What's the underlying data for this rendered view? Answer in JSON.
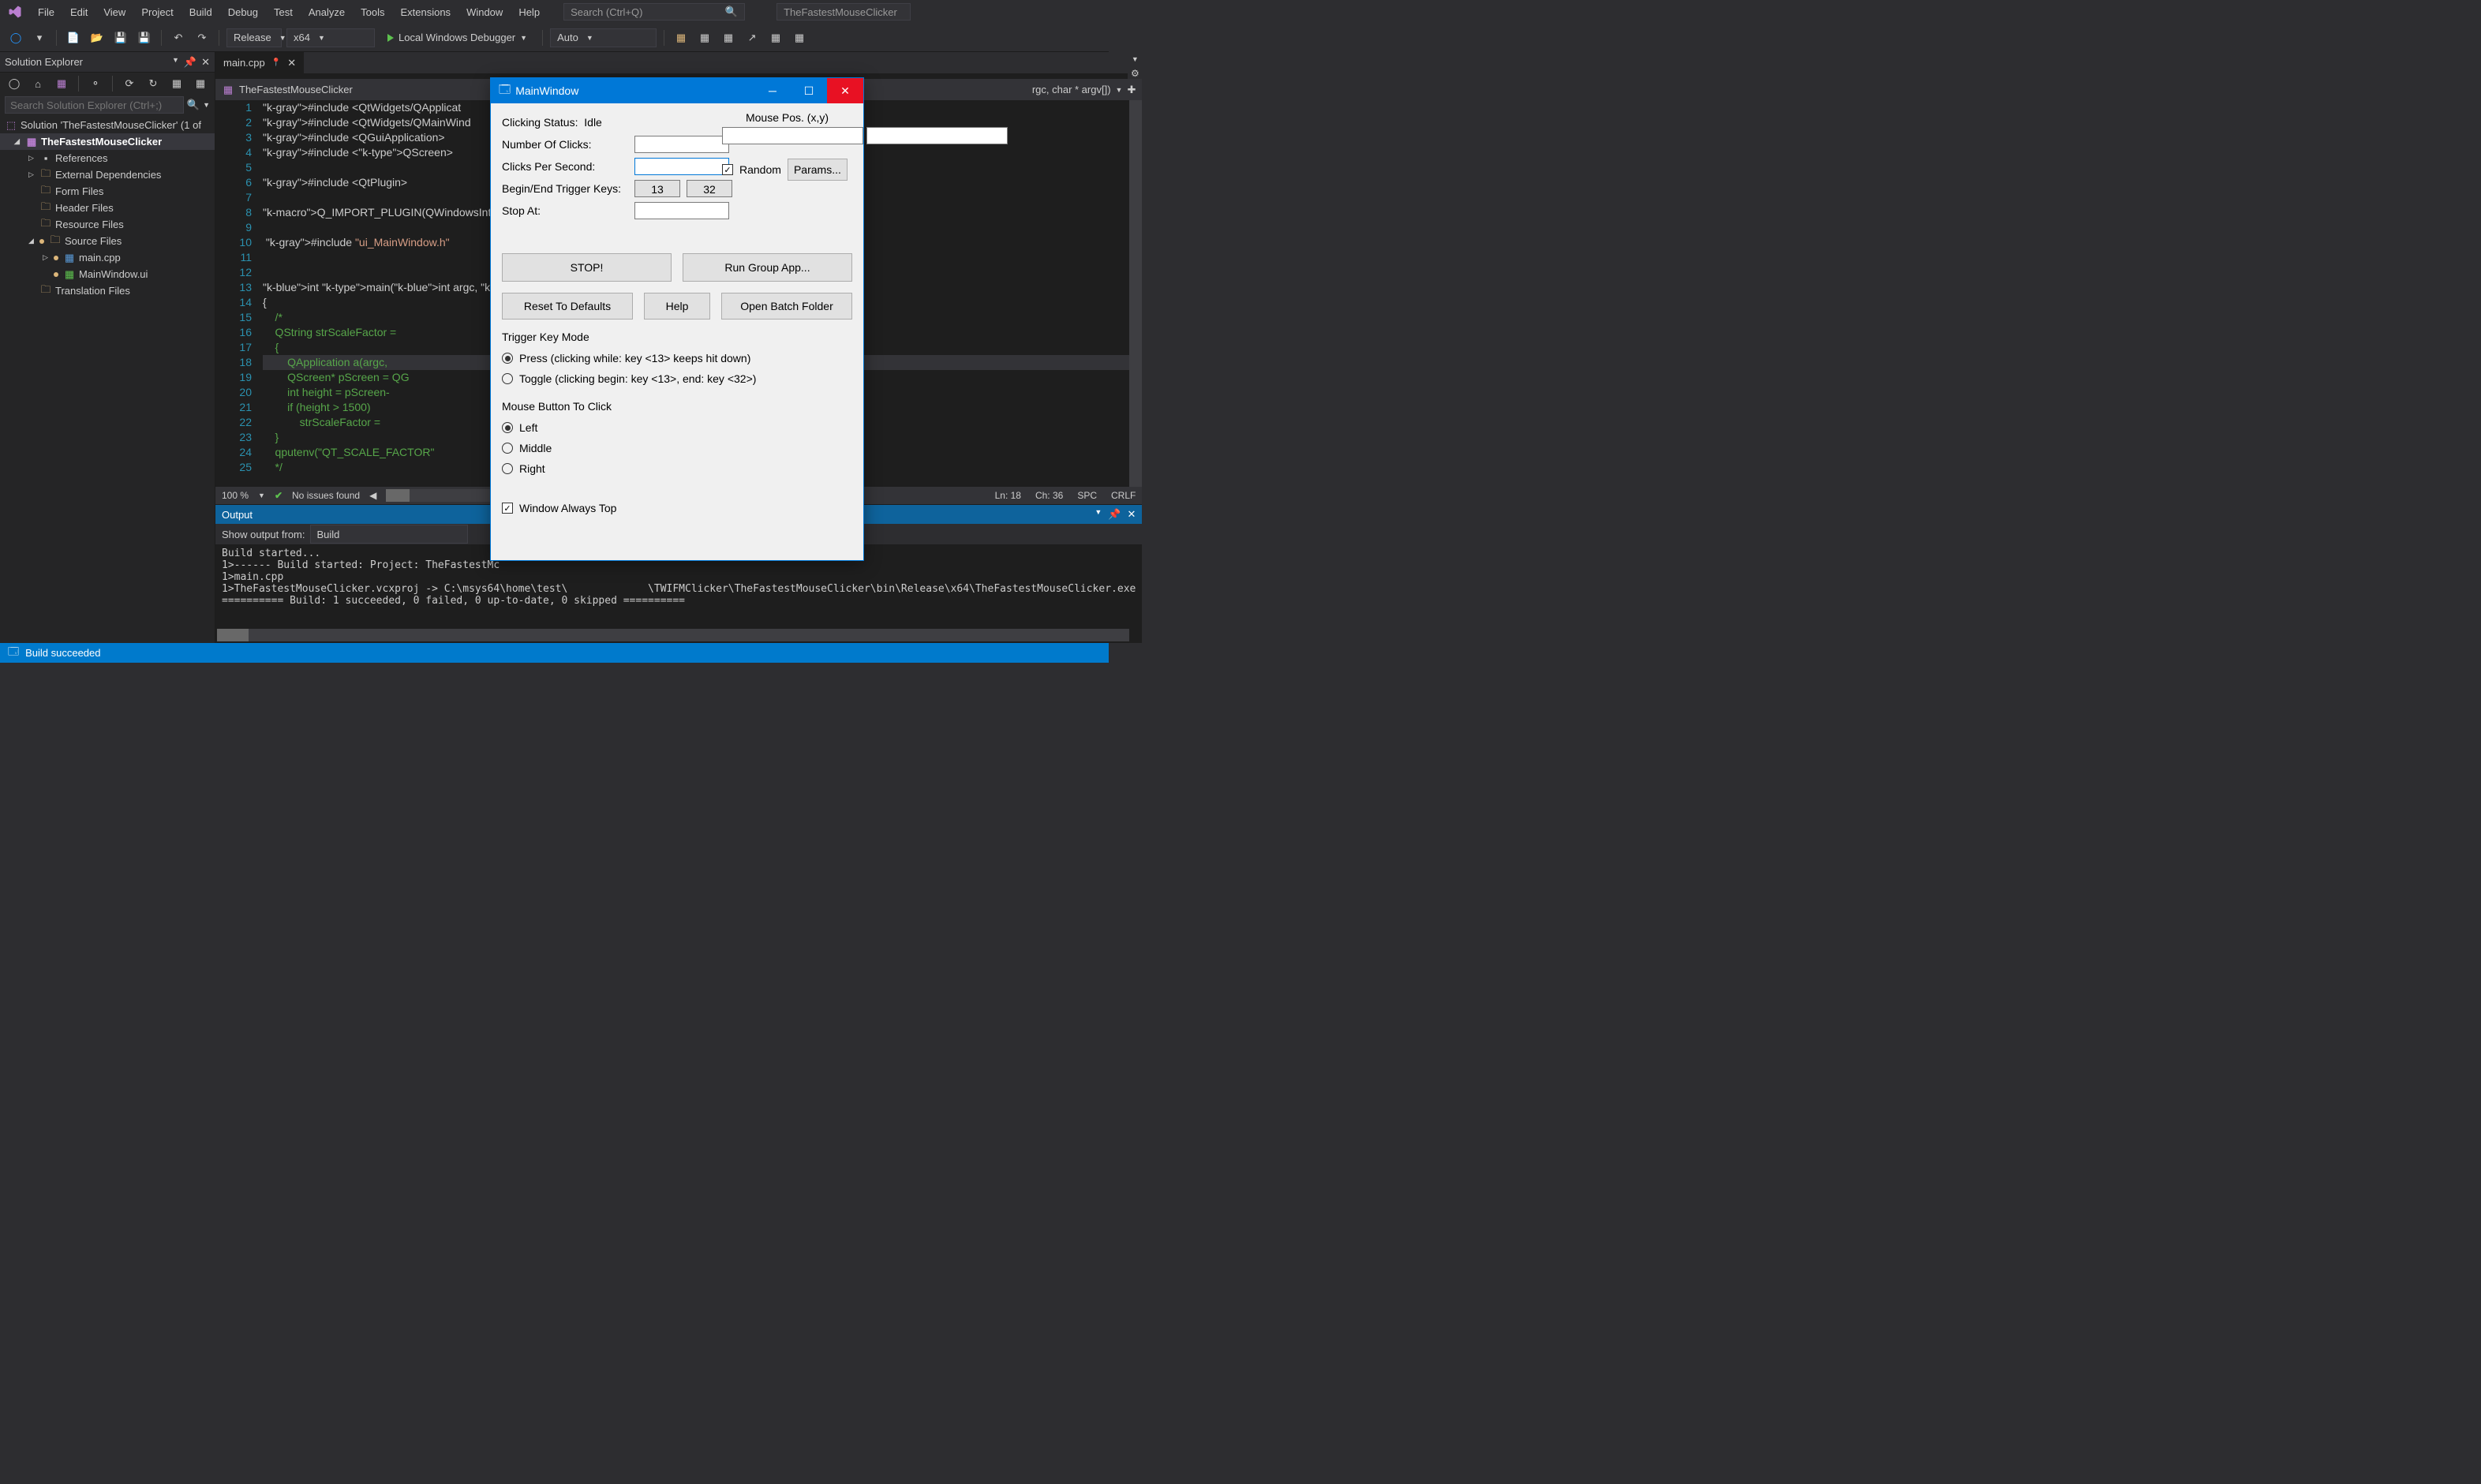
{
  "menus": [
    "File",
    "Edit",
    "View",
    "Project",
    "Build",
    "Debug",
    "Test",
    "Analyze",
    "Tools",
    "Extensions",
    "Window",
    "Help"
  ],
  "search_placeholder": "Search (Ctrl+Q)",
  "project_box": "TheFastestMouseClicker",
  "toolbar": {
    "config": "Release",
    "platform": "x64",
    "debugger": "Local Windows Debugger",
    "auto": "Auto"
  },
  "solution_explorer": {
    "title": "Solution Explorer",
    "search_placeholder": "Search Solution Explorer (Ctrl+;)",
    "root": "Solution 'TheFastestMouseClicker' (1 of",
    "project": "TheFastestMouseClicker",
    "nodes": [
      "References",
      "External Dependencies",
      "Form Files",
      "Header Files",
      "Resource Files",
      "Source Files",
      "Translation Files"
    ],
    "source_children": [
      "main.cpp",
      "MainWindow.ui"
    ]
  },
  "editor": {
    "tab": "main.cpp",
    "breadcrumb_left": "TheFastestMouseClicker",
    "breadcrumb_right": "rgc, char * argv[])",
    "zoom": "100 %",
    "issues": "No issues found",
    "status": {
      "ln": "Ln: 18",
      "ch": "Ch: 36",
      "spc": "SPC",
      "crlf": "CRLF"
    },
    "lines": [
      "#include <QtWidgets/QApplicat",
      "#include <QtWidgets/QMainWind",
      "#include <QGuiApplication>",
      "#include <QScreen>",
      "",
      "#include <QtPlugin>",
      "",
      "Q_IMPORT_PLUGIN(QWindowsInteg",
      "",
      " #include \"ui_MainWindow.h\"",
      "",
      "",
      "int main(int argc, char* argv",
      "{",
      "    /*",
      "    QString strScaleFactor = ",
      "    {",
      "        QApplication a(argc, ",
      "        QScreen* pScreen = QG",
      "        int height = pScreen-",
      "        if (height > 1500)",
      "            strScaleFactor = ",
      "    }",
      "    qputenv(\"QT_SCALE_FACTOR\"",
      "    */"
    ]
  },
  "output": {
    "title": "Output",
    "show_from_label": "Show output from:",
    "show_from_value": "Build",
    "lines": [
      "Build started...",
      "1>------ Build started: Project: TheFastestMc",
      "1>main.cpp",
      "1>TheFastestMouseClicker.vcxproj -> C:\\msys64\\home\\test\\             \\TWIFMClicker\\TheFastestMouseClicker\\bin\\Release\\x64\\TheFastestMouseClicker.exe",
      "========== Build: 1 succeeded, 0 failed, 0 up-to-date, 0 skipped =========="
    ]
  },
  "status_bar": "Build succeeded",
  "app_window": {
    "title": "MainWindow",
    "clicking_status_label": "Clicking Status:",
    "clicking_status_value": "Idle",
    "number_of_clicks": "Number Of Clicks:",
    "clicks_per_second": "Clicks Per Second:",
    "trigger_keys": "Begin/End Trigger Keys:",
    "key1": "13",
    "key2": "32",
    "stop_at": "Stop At:",
    "mouse_pos": "Mouse Pos. (x,y)",
    "random": "Random",
    "params": "Params...",
    "stop_btn": "STOP!",
    "run_group": "Run Group App...",
    "reset": "Reset To Defaults",
    "help": "Help",
    "open_batch": "Open Batch Folder",
    "trigger_mode": "Trigger Key Mode",
    "press_label": "Press (clicking while: key <13> keeps hit down)",
    "toggle_label": "Toggle (clicking begin: key <13>, end: key <32>)",
    "mouse_btn_label": "Mouse Button To Click",
    "left": "Left",
    "middle": "Middle",
    "right": "Right",
    "always_top": "Window Always Top"
  }
}
